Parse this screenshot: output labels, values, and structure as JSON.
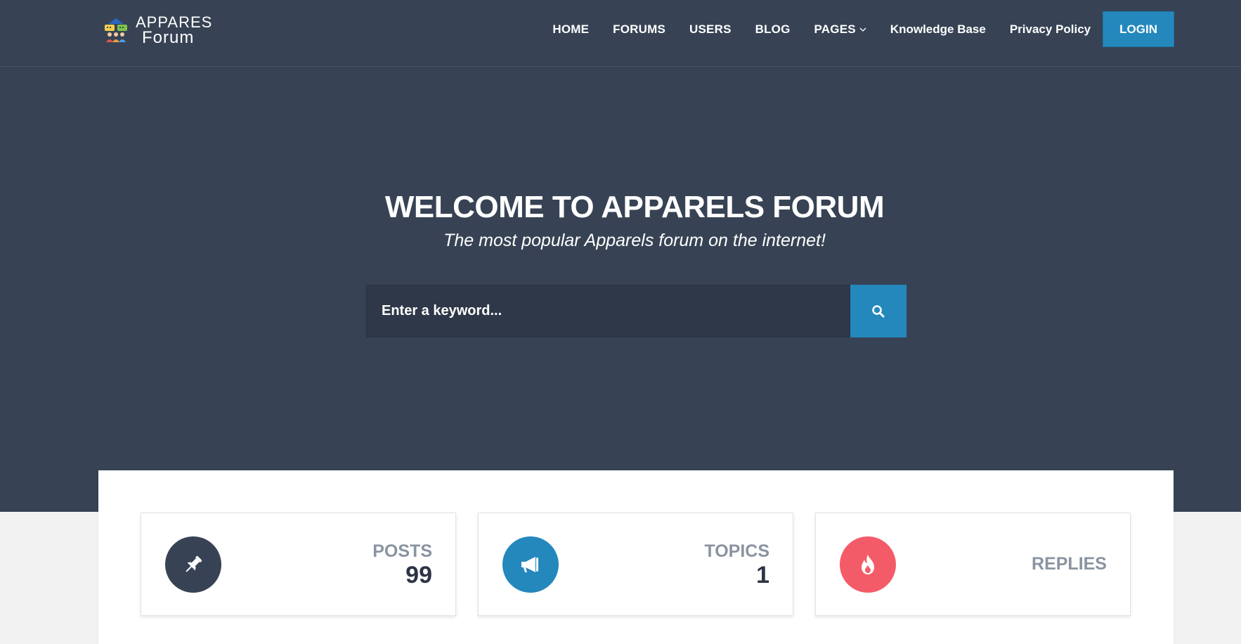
{
  "brand": {
    "line1": "APPARES",
    "line2": "Forum"
  },
  "nav": {
    "items": [
      {
        "label": "HOME"
      },
      {
        "label": "FORUMS"
      },
      {
        "label": "USERS"
      },
      {
        "label": "BLOG"
      },
      {
        "label": "PAGES"
      },
      {
        "label": "Knowledge Base"
      },
      {
        "label": "Privacy Policy"
      }
    ],
    "login": "LOGIN"
  },
  "hero": {
    "title": "WELCOME TO APPARELS FORUM",
    "subtitle": "The most popular Apparels forum on the internet!"
  },
  "search": {
    "placeholder": "Enter a keyword..."
  },
  "stats": [
    {
      "label": "POSTS",
      "value": "99",
      "icon": "pin-icon",
      "color": "#374354"
    },
    {
      "label": "TOPICS",
      "value": "1",
      "icon": "megaphone-icon",
      "color": "#2488bd"
    },
    {
      "label": "REPLIES",
      "value": "",
      "icon": "fire-icon",
      "color": "#f45b69"
    }
  ],
  "colors": {
    "header": "#374354",
    "accent": "#2488bd",
    "red": "#f45b69"
  }
}
